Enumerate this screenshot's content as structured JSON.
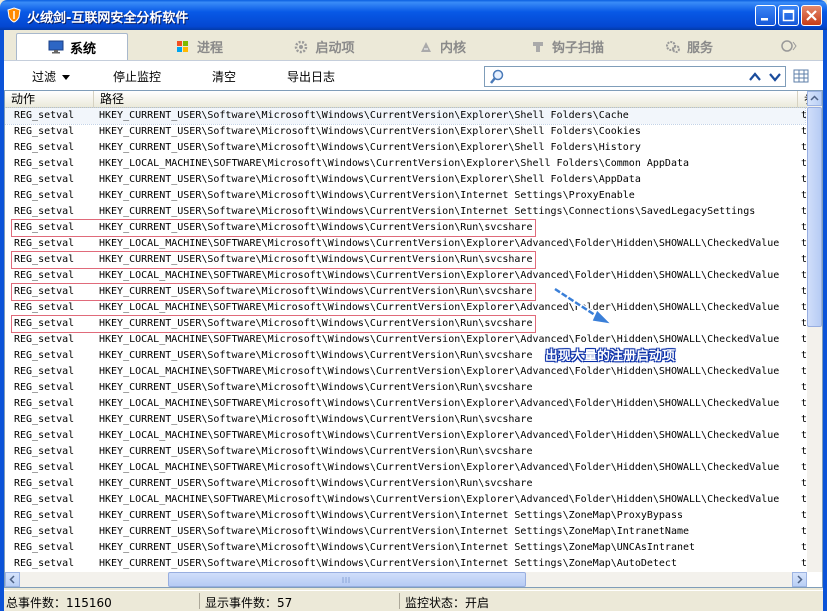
{
  "window": {
    "title": "火绒剑-互联网安全分析软件"
  },
  "tabs": [
    {
      "label": "系统",
      "icon": "monitor-icon",
      "active": true
    },
    {
      "label": "进程",
      "icon": "windows-flag-icon",
      "active": false
    },
    {
      "label": "启动项",
      "icon": "gear-icon",
      "active": false
    },
    {
      "label": "内核",
      "icon": "kernel-icon",
      "active": false
    },
    {
      "label": "钩子扫描",
      "icon": "hook-icon",
      "active": false
    },
    {
      "label": "服务",
      "icon": "service-icon",
      "active": false
    }
  ],
  "toolbar": {
    "filter_label": "过滤",
    "stop_label": "停止监控",
    "clear_label": "清空",
    "export_label": "导出日志",
    "search_placeholder": ""
  },
  "table": {
    "columns": [
      "动作",
      "路径",
      "参"
    ],
    "rows": [
      [
        "REG_setval",
        "HKEY_CURRENT_USER\\Software\\Microsoft\\Windows\\CurrentVersion\\Explorer\\Shell Folders\\Cache",
        "ty"
      ],
      [
        "REG_setval",
        "HKEY_CURRENT_USER\\Software\\Microsoft\\Windows\\CurrentVersion\\Explorer\\Shell Folders\\Cookies",
        "ty"
      ],
      [
        "REG_setval",
        "HKEY_CURRENT_USER\\Software\\Microsoft\\Windows\\CurrentVersion\\Explorer\\Shell Folders\\History",
        "ty"
      ],
      [
        "REG_setval",
        "HKEY_LOCAL_MACHINE\\SOFTWARE\\Microsoft\\Windows\\CurrentVersion\\Explorer\\Shell Folders\\Common AppData",
        "ty"
      ],
      [
        "REG_setval",
        "HKEY_CURRENT_USER\\Software\\Microsoft\\Windows\\CurrentVersion\\Explorer\\Shell Folders\\AppData",
        "ty"
      ],
      [
        "REG_setval",
        "HKEY_CURRENT_USER\\Software\\Microsoft\\Windows\\CurrentVersion\\Internet Settings\\ProxyEnable",
        "ty"
      ],
      [
        "REG_setval",
        "HKEY_CURRENT_USER\\Software\\Microsoft\\Windows\\CurrentVersion\\Internet Settings\\Connections\\SavedLegacySettings",
        "ty"
      ],
      [
        "REG_setval",
        "HKEY_CURRENT_USER\\Software\\Microsoft\\Windows\\CurrentVersion\\Run\\svcshare",
        "ty"
      ],
      [
        "REG_setval",
        "HKEY_LOCAL_MACHINE\\SOFTWARE\\Microsoft\\Windows\\CurrentVersion\\Explorer\\Advanced\\Folder\\Hidden\\SHOWALL\\CheckedValue",
        "ty"
      ],
      [
        "REG_setval",
        "HKEY_CURRENT_USER\\Software\\Microsoft\\Windows\\CurrentVersion\\Run\\svcshare",
        "ty"
      ],
      [
        "REG_setval",
        "HKEY_LOCAL_MACHINE\\SOFTWARE\\Microsoft\\Windows\\CurrentVersion\\Explorer\\Advanced\\Folder\\Hidden\\SHOWALL\\CheckedValue",
        "ty"
      ],
      [
        "REG_setval",
        "HKEY_CURRENT_USER\\Software\\Microsoft\\Windows\\CurrentVersion\\Run\\svcshare",
        "ty"
      ],
      [
        "REG_setval",
        "HKEY_LOCAL_MACHINE\\SOFTWARE\\Microsoft\\Windows\\CurrentVersion\\Explorer\\Advanced\\Folder\\Hidden\\SHOWALL\\CheckedValue",
        "ty"
      ],
      [
        "REG_setval",
        "HKEY_CURRENT_USER\\Software\\Microsoft\\Windows\\CurrentVersion\\Run\\svcshare",
        "ty"
      ],
      [
        "REG_setval",
        "HKEY_LOCAL_MACHINE\\SOFTWARE\\Microsoft\\Windows\\CurrentVersion\\Explorer\\Advanced\\Folder\\Hidden\\SHOWALL\\CheckedValue",
        "ty"
      ],
      [
        "REG_setval",
        "HKEY_CURRENT_USER\\Software\\Microsoft\\Windows\\CurrentVersion\\Run\\svcshare",
        "ty"
      ],
      [
        "REG_setval",
        "HKEY_LOCAL_MACHINE\\SOFTWARE\\Microsoft\\Windows\\CurrentVersion\\Explorer\\Advanced\\Folder\\Hidden\\SHOWALL\\CheckedValue",
        "ty"
      ],
      [
        "REG_setval",
        "HKEY_CURRENT_USER\\Software\\Microsoft\\Windows\\CurrentVersion\\Run\\svcshare",
        "ty"
      ],
      [
        "REG_setval",
        "HKEY_LOCAL_MACHINE\\SOFTWARE\\Microsoft\\Windows\\CurrentVersion\\Explorer\\Advanced\\Folder\\Hidden\\SHOWALL\\CheckedValue",
        "ty"
      ],
      [
        "REG_setval",
        "HKEY_CURRENT_USER\\Software\\Microsoft\\Windows\\CurrentVersion\\Run\\svcshare",
        "ty"
      ],
      [
        "REG_setval",
        "HKEY_LOCAL_MACHINE\\SOFTWARE\\Microsoft\\Windows\\CurrentVersion\\Explorer\\Advanced\\Folder\\Hidden\\SHOWALL\\CheckedValue",
        "ty"
      ],
      [
        "REG_setval",
        "HKEY_CURRENT_USER\\Software\\Microsoft\\Windows\\CurrentVersion\\Run\\svcshare",
        "ty"
      ],
      [
        "REG_setval",
        "HKEY_LOCAL_MACHINE\\SOFTWARE\\Microsoft\\Windows\\CurrentVersion\\Explorer\\Advanced\\Folder\\Hidden\\SHOWALL\\CheckedValue",
        "ty"
      ],
      [
        "REG_setval",
        "HKEY_CURRENT_USER\\Software\\Microsoft\\Windows\\CurrentVersion\\Run\\svcshare",
        "ty"
      ],
      [
        "REG_setval",
        "HKEY_LOCAL_MACHINE\\SOFTWARE\\Microsoft\\Windows\\CurrentVersion\\Explorer\\Advanced\\Folder\\Hidden\\SHOWALL\\CheckedValue",
        "ty"
      ],
      [
        "REG_setval",
        "HKEY_CURRENT_USER\\Software\\Microsoft\\Windows\\CurrentVersion\\Internet Settings\\ZoneMap\\ProxyBypass",
        "ty"
      ],
      [
        "REG_setval",
        "HKEY_CURRENT_USER\\Software\\Microsoft\\Windows\\CurrentVersion\\Internet Settings\\ZoneMap\\IntranetName",
        "ty"
      ],
      [
        "REG_setval",
        "HKEY_CURRENT_USER\\Software\\Microsoft\\Windows\\CurrentVersion\\Internet Settings\\ZoneMap\\UNCAsIntranet",
        "ty"
      ],
      [
        "REG_setval",
        "HKEY_CURRENT_USER\\Software\\Microsoft\\Windows\\CurrentVersion\\Internet Settings\\ZoneMap\\AutoDetect",
        "ty"
      ]
    ],
    "highlighted_rows": [
      7,
      9,
      11,
      13
    ]
  },
  "annotation": {
    "text": "出现大量的注册启动项"
  },
  "status": {
    "total_events": "总事件数：115160",
    "shown_events": "显示事件数：57",
    "monitor_state": "监控状态：开启"
  },
  "colors": {
    "titlebar": "#0a5fe0",
    "highlight_box": "#e06a7a",
    "annotation_arrow": "#3a7fd8"
  }
}
